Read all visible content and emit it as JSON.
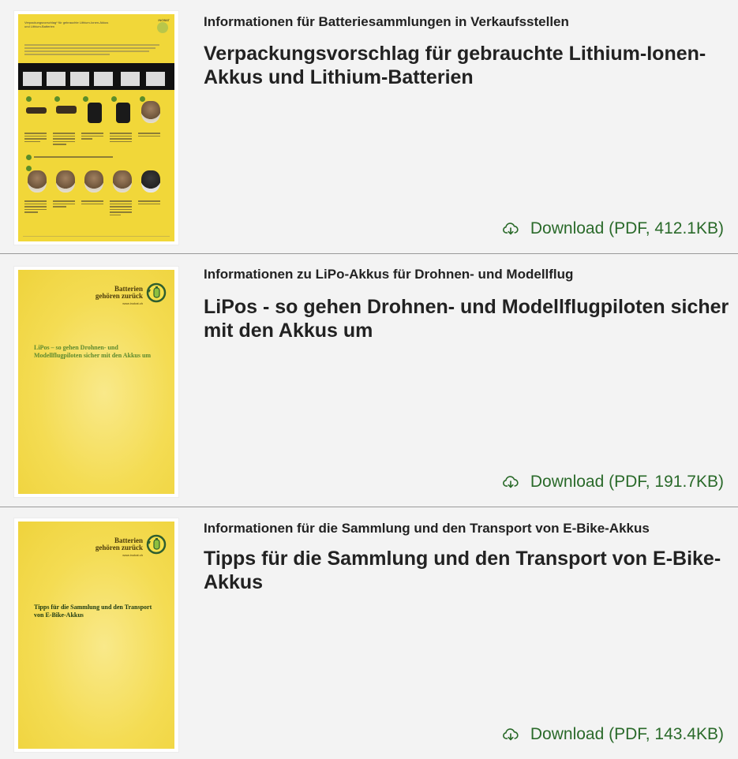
{
  "colors": {
    "accent_green": "#2a6a2a",
    "cover_yellow": "#f4dc53",
    "divider": "#9a9a9a"
  },
  "items": [
    {
      "subtitle": "Informationen für Batteriesammlungen in Verkaufsstellen",
      "title": "Verpackungsvorschlag für gebrauchte Lithium-Ionen-Akkus und Lithium-Batterien",
      "download_label": "Download (PDF, 412.1KB)",
      "download_icon": "cloud-download-icon",
      "thumbnail": {
        "heading": "Verpackungsvorschlag* für gebrauchte Lithium-Ionen-Akkus und Lithium-Batterien",
        "logo_text": "INOBAT"
      }
    },
    {
      "subtitle": "Informationen zu LiPo-Akkus für Drohnen- und Modellflug",
      "title": "LiPos - so gehen Drohnen- und Modellflugpiloten sicher mit den Akkus um",
      "download_label": "Download (PDF, 191.7KB)",
      "download_icon": "cloud-download-icon",
      "thumbnail": {
        "logo_line1": "Batterien",
        "logo_line2": "gehören zurück",
        "logo_url": "www.inobat.ch",
        "cover_title": "LiPos – so gehen Drohnen- und Modellflugpiloten sicher mit den Akkus um"
      }
    },
    {
      "subtitle": "Informationen für die Sammlung und den Transport von E-Bike-Akkus",
      "title": "Tipps für die Sammlung und den Transport von E-Bike-Akkus",
      "download_label": "Download (PDF, 143.4KB)",
      "download_icon": "cloud-download-icon",
      "thumbnail": {
        "logo_line1": "Batterien",
        "logo_line2": "gehören zurück",
        "logo_url": "www.inobat.ch",
        "cover_title": "Tipps für die Sammlung und den Transport von E-Bike-Akkus"
      }
    }
  ]
}
